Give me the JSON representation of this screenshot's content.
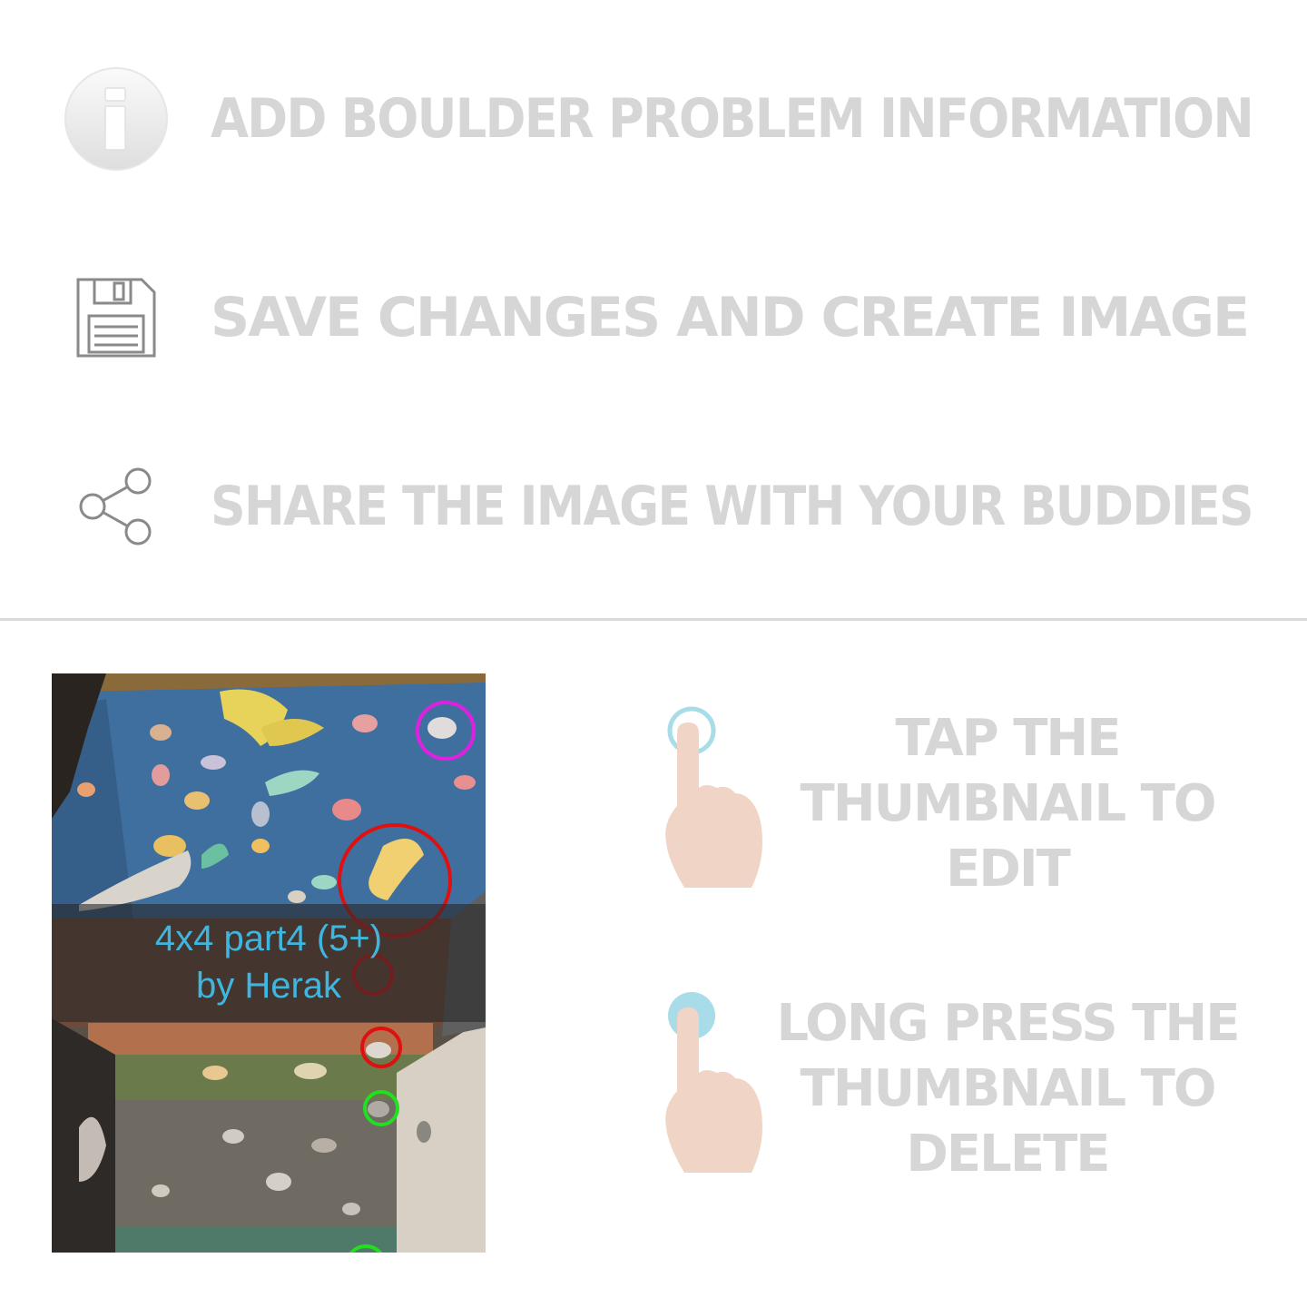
{
  "features": [
    {
      "icon": "info-icon",
      "label": "Add boulder problem information"
    },
    {
      "icon": "floppy-disk-icon",
      "label": "Save changes and create image"
    },
    {
      "icon": "share-icon",
      "label": "Share the image with your buddies"
    }
  ],
  "thumbnail": {
    "title": "4x4 part4 (5+)",
    "author": "by Herak"
  },
  "hints": {
    "tap": {
      "icon": "tap-gesture-icon",
      "label": "Tap the thumbnail to edit"
    },
    "long_press": {
      "icon": "long-press-gesture-icon",
      "label": "Long press the thumbnail to delete"
    }
  },
  "colors": {
    "feature_text": "#d6d6d6",
    "caption_text": "#3fb6df",
    "hand": "#f0d5c6",
    "tap_ring": "#a8dce8"
  }
}
